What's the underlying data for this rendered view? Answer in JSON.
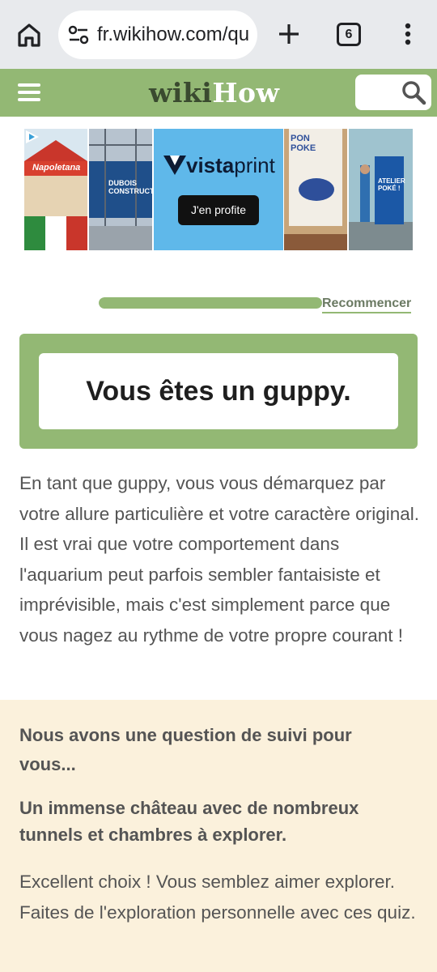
{
  "browser": {
    "url": "fr.wikihow.com/qu",
    "tab_count": "6",
    "icons": [
      "home-icon",
      "site-settings-icon",
      "plus-icon",
      "tab-switcher-icon",
      "more-vert-icon"
    ]
  },
  "header": {
    "logo_wiki": "wiki",
    "logo_how": "How",
    "brand_color": "#93b874",
    "icons": [
      "hamburger-icon",
      "search-icon"
    ]
  },
  "ad": {
    "tile1_text": "Napoletana",
    "tile2_text": "DUBOIS CONSTRUCTION",
    "logo_word1": "vista",
    "logo_word2": "print",
    "cta": "J'en profite",
    "tile4_text": "PON POKE",
    "tile5_text": "ATELIER POKÉ !"
  },
  "quiz": {
    "progress": 1.0,
    "restart_label": "Recommencer",
    "result_title": "Vous êtes un guppy.",
    "description": "En tant que guppy, vous vous démarquez par votre allure particulière et votre caractère original. Il est vrai que votre comportement dans l'aquarium peut parfois sembler fantaisiste et imprévisible, mais c'est simplement parce que vous nagez au rythme de votre propre courant !"
  },
  "followup": {
    "heading": "Nous avons une question de suivi pour vous...",
    "answer": "Un immense château avec de nombreux tunnels et chambres à explorer.",
    "body": "Excellent choix ! Vous semblez aimer explorer. Faites de l'exploration personnelle avec ces quiz.",
    "background": "#fbf1dc"
  }
}
